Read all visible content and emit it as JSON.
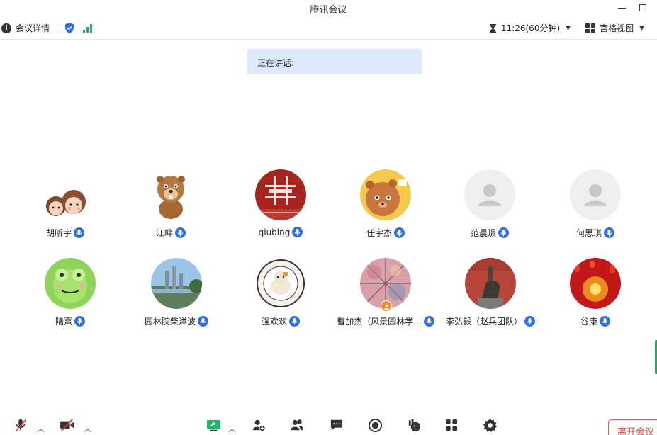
{
  "window": {
    "title": "腾讯会议"
  },
  "toolbar": {
    "meeting_info": "会议详情",
    "timer": "11:26(60分钟)",
    "view_mode": "宫格视图"
  },
  "speaking": {
    "label": "正在讲话:"
  },
  "participants": [
    {
      "name": "胡昕宇"
    },
    {
      "name": "江畔"
    },
    {
      "name": "qiubing"
    },
    {
      "name": "任宇杰"
    },
    {
      "name": "范晨璟"
    },
    {
      "name": "何思琪"
    },
    {
      "name": "陆熹"
    },
    {
      "name": "园林院柴洋波"
    },
    {
      "name": "强欢欢"
    },
    {
      "name": "曹加杰（风景园林学..."
    },
    {
      "name": "李弘毅（赵兵团队）"
    },
    {
      "name": "谷康"
    }
  ],
  "bottombar": {
    "leave_label": "离开会议"
  },
  "colors": {
    "accent_blue": "#2f6fe5",
    "speaking_bg": "#dce9fb",
    "signal_green": "#19b35b",
    "leave_red": "#e04040",
    "share_green": "#1db86a"
  }
}
